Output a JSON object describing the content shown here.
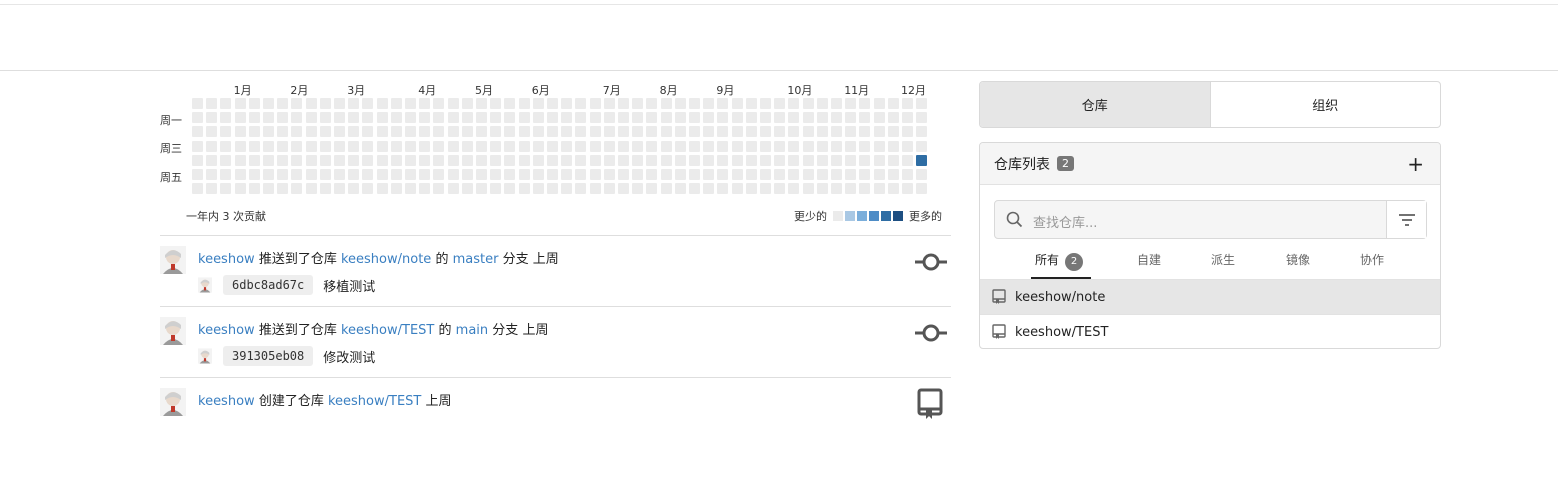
{
  "heatmap": {
    "months": [
      "1月",
      "2月",
      "3月",
      "4月",
      "5月",
      "6月",
      "7月",
      "8月",
      "9月",
      "10月",
      "11月",
      "12月"
    ],
    "month_weeks": [
      3,
      7,
      11,
      16,
      20,
      24,
      29,
      33,
      37,
      42,
      46,
      50
    ],
    "day_labels": [
      "周一",
      "周三",
      "周五"
    ],
    "total_label": "一年内 3 次贡献",
    "legend_less": "更少的",
    "legend_more": "更多的",
    "legend_colors": [
      "#ebebeb",
      "#a9c8e4",
      "#7aaedb",
      "#4e8cc6",
      "#2e6da4",
      "#1d4f82"
    ],
    "weeks": 52,
    "active_cells": [
      {
        "week": 51,
        "day": 4,
        "level": 4
      }
    ]
  },
  "feed": [
    {
      "user": "keeshow",
      "action": "推送到了仓库",
      "repo": "keeshow/note",
      "of": "的",
      "branch": "master",
      "branch_suffix": "分支",
      "time": "上周",
      "commit_sha": "6dbc8ad67c",
      "commit_msg": "移植测试",
      "icon": "git-commit-icon"
    },
    {
      "user": "keeshow",
      "action": "推送到了仓库",
      "repo": "keeshow/TEST",
      "of": "的",
      "branch": "main",
      "branch_suffix": "分支",
      "time": "上周",
      "commit_sha": "391305eb08",
      "commit_msg": "修改测试",
      "icon": "git-commit-icon"
    },
    {
      "user": "keeshow",
      "action": "创建了仓库",
      "repo": "keeshow/TEST",
      "time": "上周",
      "icon": "repo-icon"
    }
  ],
  "tabs": {
    "repos": "仓库",
    "orgs": "组织"
  },
  "repo_panel": {
    "title": "仓库列表",
    "count": "2",
    "search_placeholder": "查找仓库...",
    "filters": {
      "all": "所有",
      "all_count": "2",
      "own": "自建",
      "fork": "派生",
      "mirror": "镜像",
      "collab": "协作"
    },
    "repos": [
      "keeshow/note",
      "keeshow/TEST"
    ]
  }
}
